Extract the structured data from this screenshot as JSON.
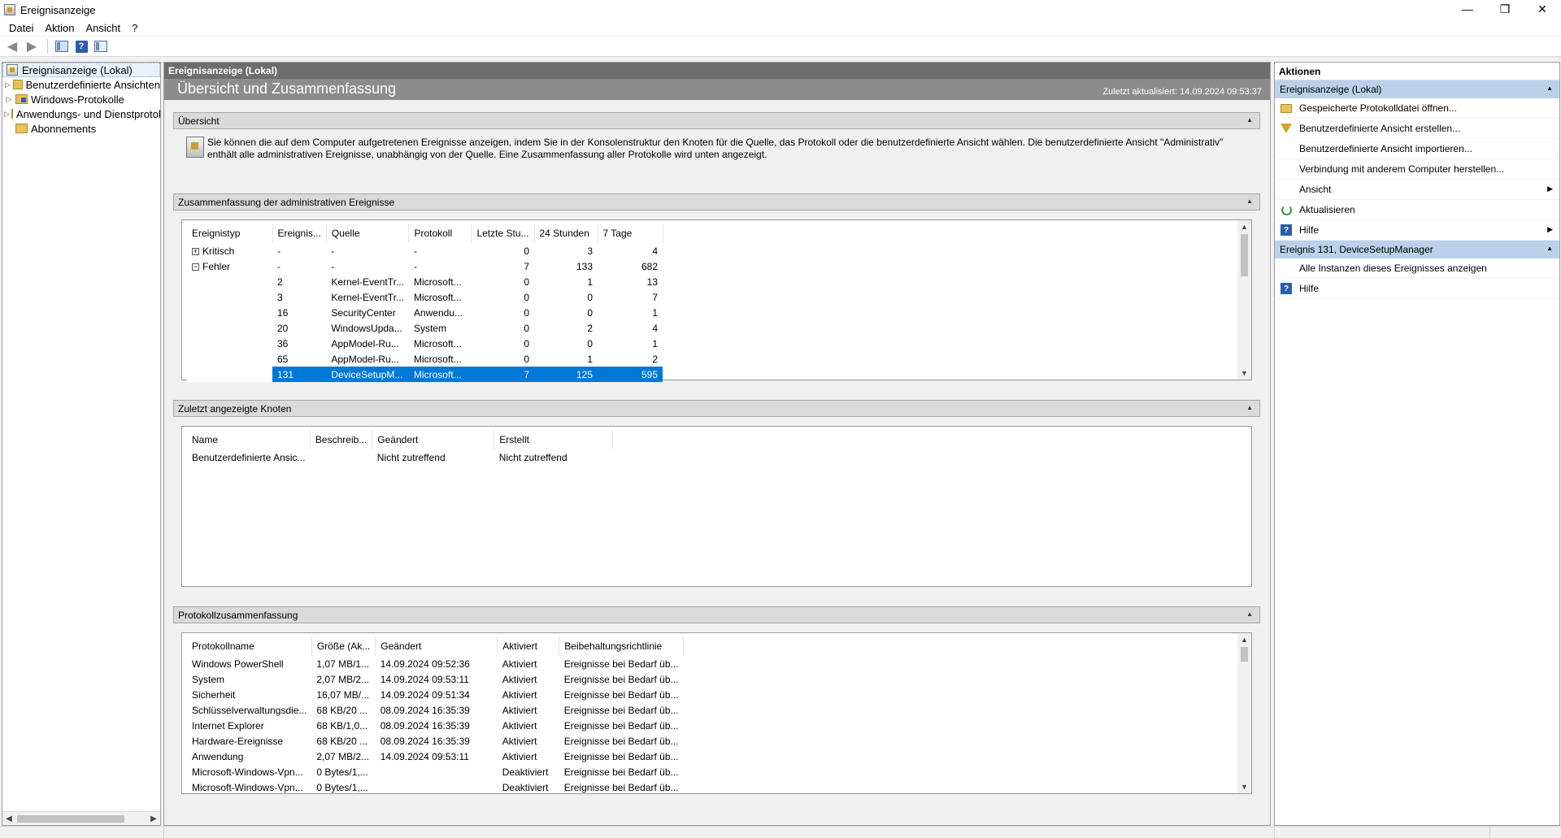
{
  "window": {
    "title": "Ereignisanzeige",
    "minimize": "—",
    "restore": "❐",
    "close": "✕"
  },
  "menu": [
    "Datei",
    "Aktion",
    "Ansicht",
    "?"
  ],
  "tree": {
    "root": "Ereignisanzeige (Lokal)",
    "items": [
      "Benutzerdefinierte Ansichten",
      "Windows-Protokolle",
      "Anwendungs- und Dienstprotokolle",
      "Abonnements"
    ]
  },
  "center": {
    "header": "Ereignisanzeige (Lokal)",
    "title": "Übersicht und Zusammenfassung",
    "updated": "Zuletzt aktualisiert: 14.09.2024 09:53:37",
    "overview": {
      "label": "Übersicht",
      "text": "Sie können die auf dem Computer aufgetretenen Ereignisse anzeigen, indem Sie in der Konsolenstruktur den Knoten für die Quelle, das Protokoll oder die benutzerdefinierte Ansicht wählen. Die benutzerdefinierte Ansicht \"Administrativ\" enthält alle administrativen Ereignisse, unabhängig von der Quelle. Eine Zusammenfassung aller Protokolle wird unten angezeigt."
    },
    "summary": {
      "label": "Zusammenfassung der administrativen Ereignisse",
      "columns": [
        "Ereignistyp",
        "Ereignis...",
        "Quelle",
        "Protokoll",
        "Letzte Stu...",
        "24 Stunden",
        "7 Tage"
      ],
      "groups": [
        {
          "type": "Kritisch",
          "id": "-",
          "source": "-",
          "log": "-",
          "hour": "0",
          "day": "3",
          "week": "4",
          "expander": "+"
        },
        {
          "type": "Fehler",
          "id": "-",
          "source": "-",
          "log": "-",
          "hour": "7",
          "day": "133",
          "week": "682",
          "expander": "−"
        }
      ],
      "rows": [
        {
          "id": "2",
          "source": "Kernel-EventTr...",
          "log": "Microsoft...",
          "hour": "0",
          "day": "1",
          "week": "13"
        },
        {
          "id": "3",
          "source": "Kernel-EventTr...",
          "log": "Microsoft...",
          "hour": "0",
          "day": "0",
          "week": "7"
        },
        {
          "id": "16",
          "source": "SecurityCenter",
          "log": "Anwendu...",
          "hour": "0",
          "day": "0",
          "week": "1"
        },
        {
          "id": "20",
          "source": "WindowsUpda...",
          "log": "System",
          "hour": "0",
          "day": "2",
          "week": "4"
        },
        {
          "id": "36",
          "source": "AppModel-Ru...",
          "log": "Microsoft...",
          "hour": "0",
          "day": "0",
          "week": "1"
        },
        {
          "id": "65",
          "source": "AppModel-Ru...",
          "log": "Microsoft...",
          "hour": "0",
          "day": "1",
          "week": "2"
        },
        {
          "id": "131",
          "source": "DeviceSetupM...",
          "log": "Microsoft...",
          "hour": "7",
          "day": "125",
          "week": "595"
        }
      ]
    },
    "recent": {
      "label": "Zuletzt angezeigte Knoten",
      "columns": [
        "Name",
        "Beschreib...",
        "Geändert",
        "Erstellt"
      ],
      "rows": [
        {
          "name": "Benutzerdefinierte Ansic...",
          "desc": "",
          "changed": "Nicht zutreffend",
          "created": "Nicht zutreffend"
        }
      ]
    },
    "logs": {
      "label": "Protokollzusammenfassung",
      "columns": [
        "Protokollname",
        "Größe (Ak...",
        "Geändert",
        "Aktiviert",
        "Beibehaltungsrichtlinie"
      ],
      "rows": [
        {
          "name": "Windows PowerShell",
          "size": "1,07 MB/1...",
          "changed": "14.09.2024 09:52:36",
          "enabled": "Aktiviert",
          "policy": "Ereignisse bei Bedarf üb..."
        },
        {
          "name": "System",
          "size": "2,07 MB/2...",
          "changed": "14.09.2024 09:53:11",
          "enabled": "Aktiviert",
          "policy": "Ereignisse bei Bedarf üb..."
        },
        {
          "name": "Sicherheit",
          "size": "16,07 MB/...",
          "changed": "14.09.2024 09:51:34",
          "enabled": "Aktiviert",
          "policy": "Ereignisse bei Bedarf üb..."
        },
        {
          "name": "Schlüsselverwaltungsdie...",
          "size": "68 KB/20 ...",
          "changed": "08.09.2024 16:35:39",
          "enabled": "Aktiviert",
          "policy": "Ereignisse bei Bedarf üb..."
        },
        {
          "name": "Internet Explorer",
          "size": "68 KB/1,0...",
          "changed": "08.09.2024 16:35:39",
          "enabled": "Aktiviert",
          "policy": "Ereignisse bei Bedarf üb..."
        },
        {
          "name": "Hardware-Ereignisse",
          "size": "68 KB/20 ...",
          "changed": "08.09.2024 16:35:39",
          "enabled": "Aktiviert",
          "policy": "Ereignisse bei Bedarf üb..."
        },
        {
          "name": "Anwendung",
          "size": "2,07 MB/2...",
          "changed": "14.09.2024 09:53:11",
          "enabled": "Aktiviert",
          "policy": "Ereignisse bei Bedarf üb..."
        },
        {
          "name": "Microsoft-Windows-Vpn...",
          "size": "0 Bytes/1,...",
          "changed": "",
          "enabled": "Deaktiviert",
          "policy": "Ereignisse bei Bedarf üb..."
        },
        {
          "name": "Microsoft-Windows-Vpn...",
          "size": "0 Bytes/1,...",
          "changed": "",
          "enabled": "Deaktiviert",
          "policy": "Ereignisse bei Bedarf üb..."
        }
      ]
    }
  },
  "actions": {
    "header": "Aktionen",
    "group1": {
      "title": "Ereignisanzeige (Lokal)",
      "items": [
        {
          "label": "Gespeicherte Protokolldatei öffnen...",
          "icon": "open-folder-icon"
        },
        {
          "label": "Benutzerdefinierte Ansicht erstellen...",
          "icon": "filter-icon"
        },
        {
          "label": "Benutzerdefinierte Ansicht importieren...",
          "icon": ""
        },
        {
          "label": "Verbindung mit anderem Computer herstellen...",
          "icon": ""
        },
        {
          "label": "Ansicht",
          "icon": "",
          "submenu": true
        },
        {
          "label": "Aktualisieren",
          "icon": "refresh-icon"
        },
        {
          "label": "Hilfe",
          "icon": "help-icon",
          "submenu": true
        }
      ]
    },
    "group2": {
      "title": "Ereignis 131, DeviceSetupManager",
      "items": [
        {
          "label": "Alle Instanzen dieses Ereignisses anzeigen",
          "icon": ""
        },
        {
          "label": "Hilfe",
          "icon": "help-icon"
        }
      ]
    }
  },
  "colors": {
    "selection": "#0078d7",
    "group_header": "#b9d1ea",
    "center_header": "#6d6d6d"
  }
}
